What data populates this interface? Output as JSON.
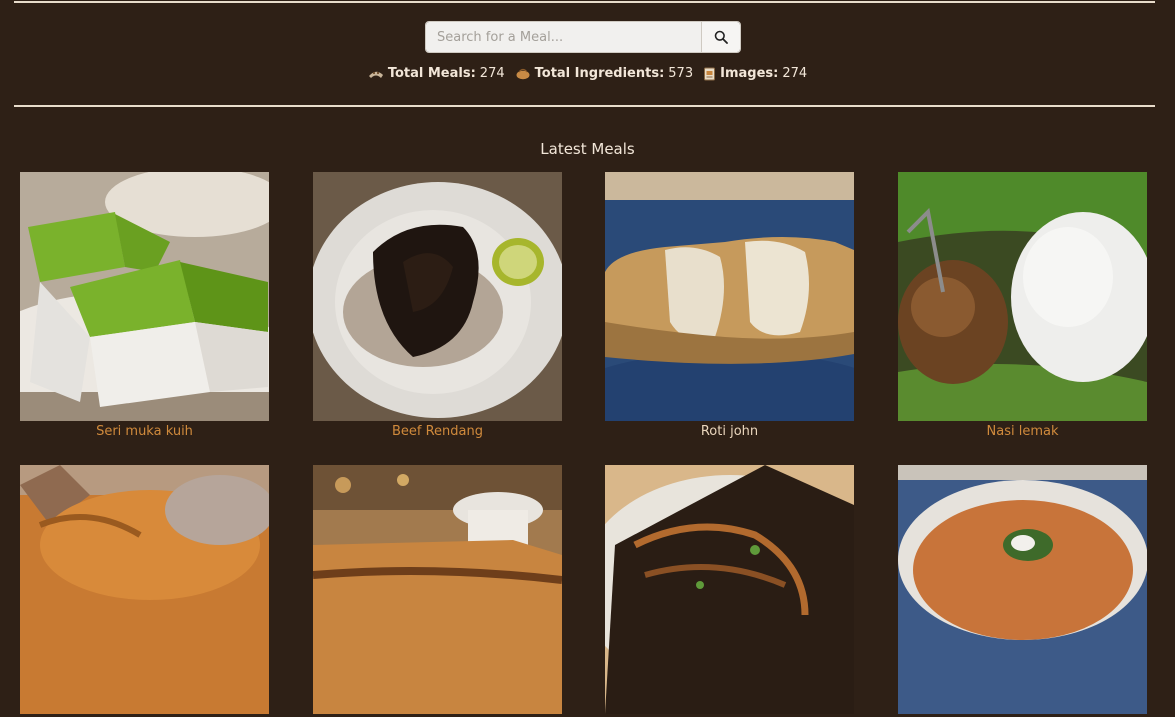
{
  "search": {
    "placeholder": "Search for a Meal..."
  },
  "stats": [
    {
      "icon": "meal-icon",
      "label": "Total Meals:",
      "value": "274"
    },
    {
      "icon": "ingredients-icon",
      "label": "Total Ingredients:",
      "value": "573"
    },
    {
      "icon": "images-icon",
      "label": "Images:",
      "value": "274"
    }
  ],
  "section": {
    "title": "Latest Meals"
  },
  "meals": [
    {
      "name": "Seri muka kuih"
    },
    {
      "name": "Beef Rendang"
    },
    {
      "name": "Roti john"
    },
    {
      "name": "Nasi lemak"
    },
    {
      "name": ""
    },
    {
      "name": ""
    },
    {
      "name": ""
    },
    {
      "name": ""
    }
  ],
  "colors": {
    "background": "#2e2016",
    "link": "#d08a3c",
    "link_hover": "#ead6bd",
    "text": "#f2e6d8"
  }
}
